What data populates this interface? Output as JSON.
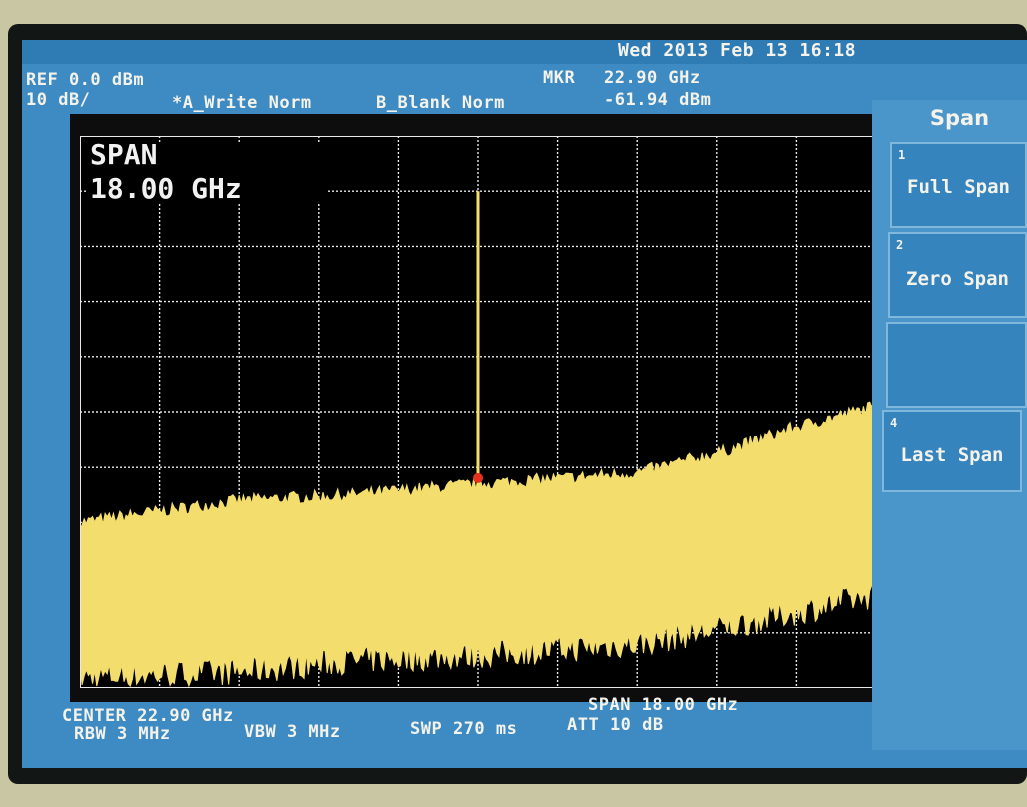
{
  "header": {
    "datetime": "Wed 2013 Feb 13 16:18",
    "ref_level": "REF 0.0 dBm",
    "scale": "10 dB/",
    "trace_a": "*A_Write Norm",
    "trace_b": "B_Blank Norm",
    "marker_label": "MKR",
    "marker_freq": "22.90 GHz",
    "marker_amp": "-61.94 dBm"
  },
  "plot": {
    "span_label": "SPAN",
    "span_value": "18.00 GHz",
    "trace_color": "#f3dd6c",
    "grid_color": "#e8e8e8",
    "background": "#000000",
    "marker_color": "#e53020",
    "divisions_x": 10,
    "divisions_y": 10
  },
  "footer": {
    "center": "CENTER 22.90 GHz",
    "span": "SPAN 18.00 GHz",
    "rbw": "RBW 3 MHz",
    "vbw": "VBW 3 MHz",
    "swp": "SWP 270 ms",
    "att": "ATT 10 dB"
  },
  "softkeys": {
    "title": "Span",
    "keys": [
      {
        "num": "1",
        "label": "Full Span"
      },
      {
        "num": "2",
        "label": "Zero Span"
      },
      {
        "num": "4",
        "label": "Last Span"
      }
    ]
  },
  "chart_data": {
    "type": "line",
    "x_center": 22.9,
    "x_span": 18.0,
    "xlim": [
      13.9,
      31.9
    ],
    "ylim": [
      -100,
      0
    ],
    "y_ref": 0.0,
    "y_per_div": 10,
    "grid": true,
    "marker": {
      "x": 22.9,
      "y": -61.94
    },
    "noise_floor_top": [
      [
        13.9,
        -70
      ],
      [
        14.8,
        -69
      ],
      [
        17.5,
        -66
      ],
      [
        20.0,
        -65
      ],
      [
        22.9,
        -63
      ],
      [
        24.8,
        -62
      ],
      [
        26.5,
        -61
      ],
      [
        28.5,
        -57
      ],
      [
        30.0,
        -53
      ],
      [
        31.9,
        -49
      ]
    ],
    "noise_floor_bottom": [
      [
        13.9,
        -98
      ],
      [
        17.5,
        -97
      ],
      [
        20.0,
        -95
      ],
      [
        22.9,
        -94
      ],
      [
        26.5,
        -92
      ],
      [
        28.5,
        -89
      ],
      [
        31.9,
        -83
      ]
    ],
    "spike": {
      "x": 22.9,
      "y": -10
    }
  }
}
